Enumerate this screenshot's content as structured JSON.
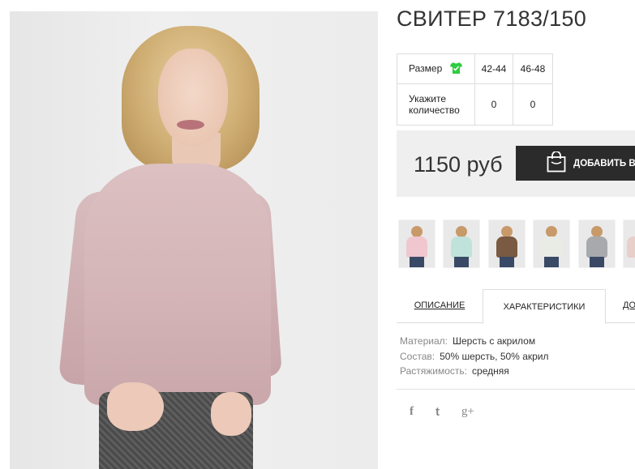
{
  "product": {
    "title": "СВИТЕР 7183/150",
    "price": "1150 руб",
    "add_to_cart_label": "ДОБАВИТЬ В"
  },
  "size_table": {
    "size_label": "Размер",
    "size_icon": "shirt-icon",
    "sizes": [
      "42-44",
      "46-48"
    ],
    "quantity_label": "Укажите количество",
    "quantities": [
      "0",
      "0"
    ]
  },
  "thumbnails": [
    {
      "color": "#f0c7cf"
    },
    {
      "color": "#bfe3da"
    },
    {
      "color": "#7a5a42"
    },
    {
      "color": "#e9ece4"
    },
    {
      "color": "#a8a9ad"
    },
    {
      "color": "#e8cfc9"
    }
  ],
  "tabs": [
    {
      "label": "ОПИСАНИЕ",
      "active": false
    },
    {
      "label": "ХАРАКТЕРИСТИКИ",
      "active": true
    },
    {
      "label": "ДО",
      "active": false
    }
  ],
  "specs": [
    {
      "key": "Материал:",
      "value": "Шерсть с акрилом"
    },
    {
      "key": "Состав:",
      "value": "50% шерсть, 50% акрил"
    },
    {
      "key": "Растяжимость:",
      "value": "средняя"
    }
  ],
  "social": [
    "f",
    "t",
    "g+"
  ],
  "colors": {
    "accent_button": "#2b2b2b",
    "price_bg": "#efefef",
    "shirt_icon": "#2ecc40"
  }
}
